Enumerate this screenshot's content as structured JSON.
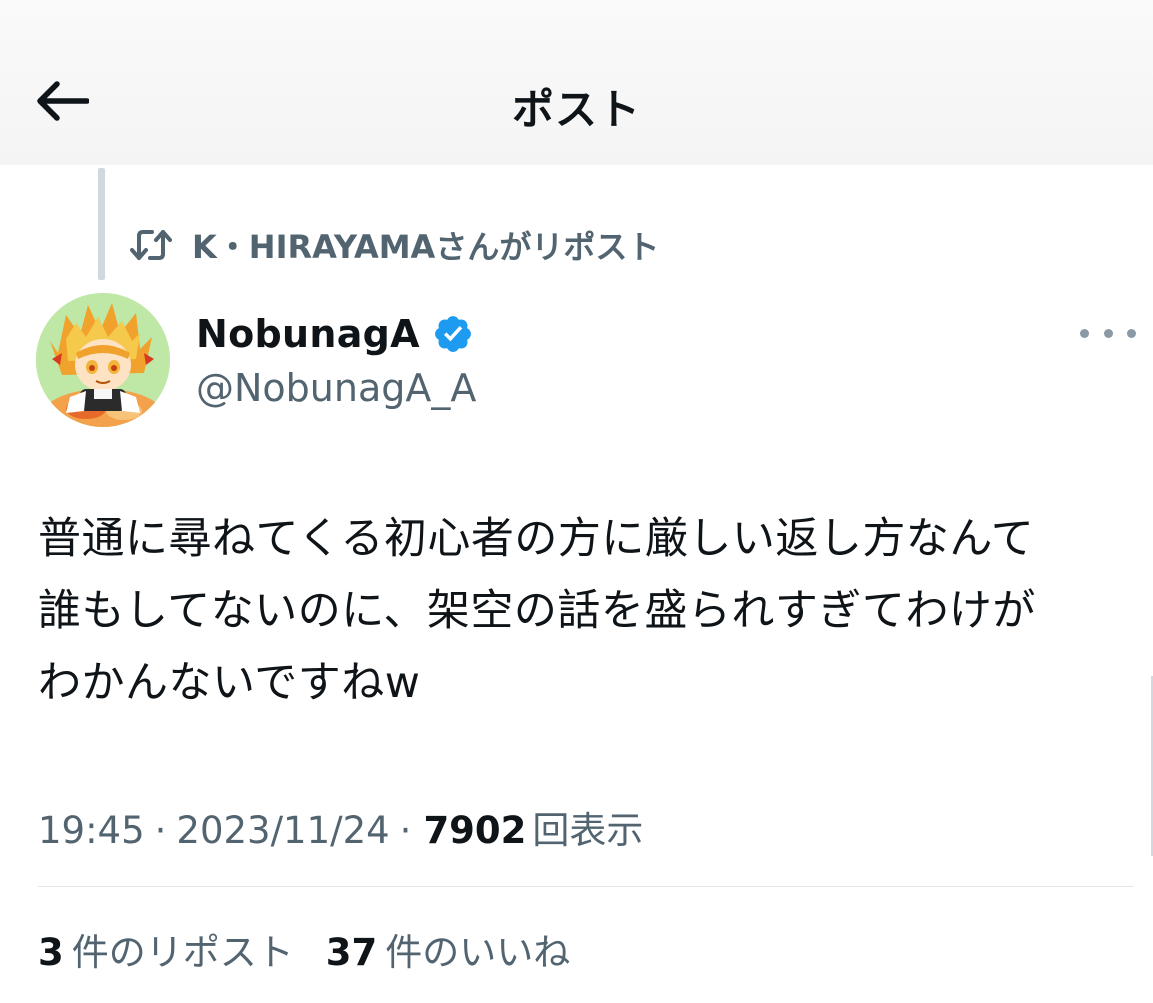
{
  "header": {
    "title": "ポスト",
    "back_icon": "arrow-left-icon"
  },
  "repost_context": {
    "icon": "retweet-icon",
    "text": "K・HIRAYAMAさんがリポスト"
  },
  "author": {
    "display_name": "NobunagA",
    "handle": "@NobunagA_A",
    "verified": true,
    "verified_color": "#1d9bf0",
    "avatar_icon": "avatar-anime-character"
  },
  "post": {
    "lines": [
      "普通に尋ねてくる初心者の方に厳しい返し方なんて",
      "誰もしてないのに、架空の話を盛られすぎてわけが",
      "わかんないですねw"
    ],
    "time": "19:45",
    "date": "2023/11/24",
    "views_count": "7902",
    "views_label": "回表示"
  },
  "stats": {
    "reposts_count": "3",
    "reposts_label": "件のリポスト",
    "likes_count": "37",
    "likes_label": "件のいいね"
  },
  "colors": {
    "text_primary": "#0f1419",
    "text_secondary": "#536471",
    "accent": "#1d9bf0"
  }
}
